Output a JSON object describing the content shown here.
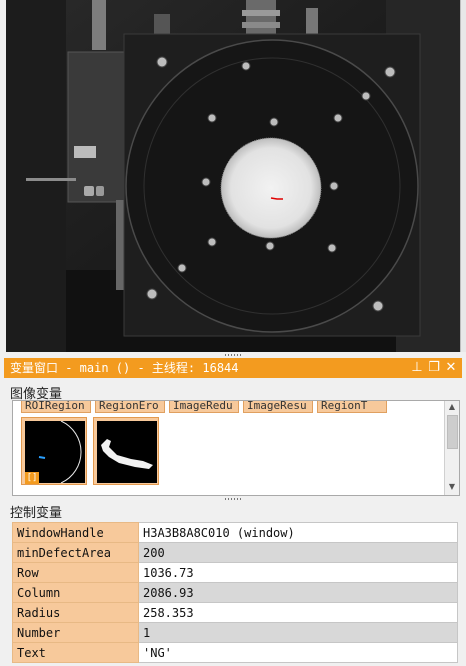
{
  "variable_window": {
    "title": "变量窗口 - main () - 主线程: 16844",
    "colors": {
      "title_bar": "#f39b1f",
      "object_tab": "#f7c99b",
      "name_cell": "#f7c99b"
    },
    "iconic_section_label": "图像变量",
    "iconic_tabs": [
      "ROIRegion",
      "RegionEro",
      "ImageRedu",
      "ImageResu",
      "RegionT"
    ],
    "thumbnail_badge": "[]",
    "control_section_label": "控制变量",
    "control_rows": [
      {
        "name": "WindowHandle",
        "value": "H3A3B8A8C010 (window)"
      },
      {
        "name": "minDefectArea",
        "value": "200"
      },
      {
        "name": "Row",
        "value": "1036.73"
      },
      {
        "name": "Column",
        "value": "2086.93"
      },
      {
        "name": "Radius",
        "value": "258.353"
      },
      {
        "name": "Number",
        "value": "1"
      },
      {
        "name": "Text",
        "value": "'NG'"
      }
    ]
  }
}
